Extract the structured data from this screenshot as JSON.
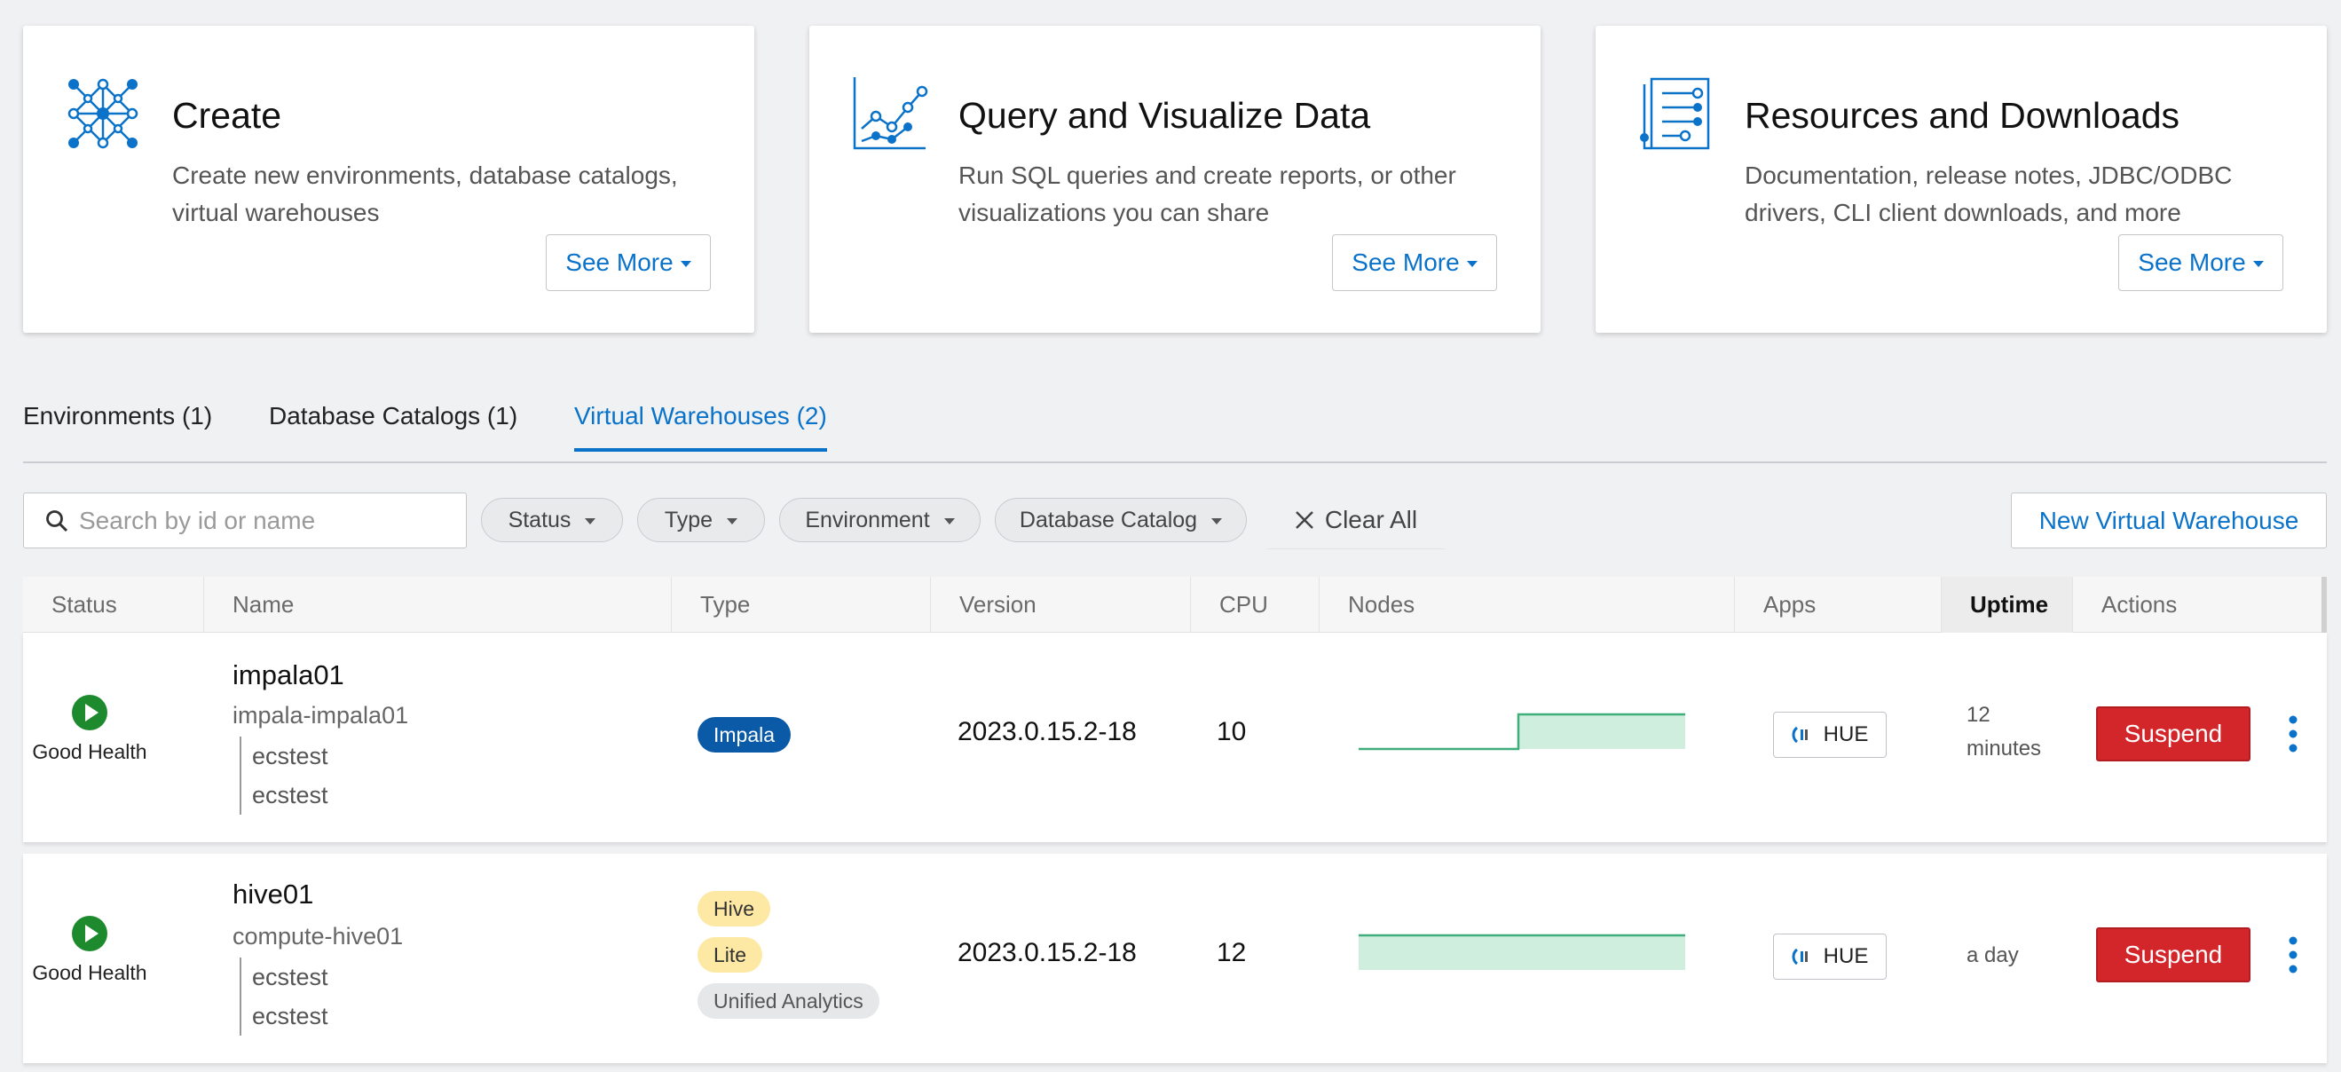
{
  "cards": [
    {
      "icon": "network-nodes-icon",
      "title": "Create",
      "description": "Create new environments, database catalogs, virtual warehouses",
      "button_label": "See More"
    },
    {
      "icon": "line-chart-icon",
      "title": "Query and Visualize Data",
      "description": "Run SQL queries and create reports, or other visualizations you can share",
      "button_label": "See More"
    },
    {
      "icon": "document-list-icon",
      "title": "Resources and Downloads",
      "description": "Documentation, release notes, JDBC/ODBC drivers, CLI client downloads, and more",
      "button_label": "See More"
    }
  ],
  "tabs": [
    {
      "label": "Environments (1)",
      "active": false
    },
    {
      "label": "Database Catalogs (1)",
      "active": false
    },
    {
      "label": "Virtual Warehouses (2)",
      "active": true
    }
  ],
  "filters": {
    "search_placeholder": "Search by id or name",
    "search_value": "",
    "pills": [
      "Status",
      "Type",
      "Environment",
      "Database Catalog"
    ],
    "clear_all": "Clear All",
    "new_button": "New Virtual Warehouse"
  },
  "table": {
    "columns": [
      "Status",
      "Name",
      "Type",
      "Version",
      "CPU",
      "Nodes",
      "Apps",
      "Uptime",
      "Actions"
    ],
    "sorted_column": "Uptime",
    "rows": [
      {
        "health": "Good Health",
        "name": "impala01",
        "id": "impala-impala01",
        "environment": "ecstest",
        "catalog": "ecstest",
        "types": [
          "Impala"
        ],
        "version": "2023.0.15.2-18",
        "cpu": "10",
        "nodes_trend": "step-up",
        "app": "HUE",
        "uptime_line1": "12",
        "uptime_line2": "minutes",
        "action": "Suspend"
      },
      {
        "health": "Good Health",
        "name": "hive01",
        "id": "compute-hive01",
        "environment": "ecstest",
        "catalog": "ecstest",
        "types": [
          "Hive",
          "Lite",
          "Unified Analytics"
        ],
        "version": "2023.0.15.2-18",
        "cpu": "12",
        "nodes_trend": "flat",
        "app": "HUE",
        "uptime_line1": "a day",
        "uptime_line2": "",
        "action": "Suspend"
      }
    ]
  },
  "colors": {
    "accent": "#0a73c9",
    "suspend": "#d3262b",
    "healthy": "#1e8a2e",
    "impala_badge": "#0b5aa8",
    "hive_badge": "#fde8a4",
    "nodes_fill": "#cfeedd",
    "nodes_line": "#3fae7a"
  }
}
